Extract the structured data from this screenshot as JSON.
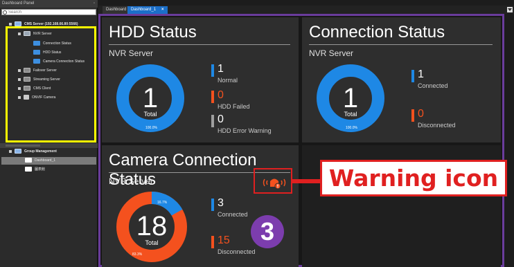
{
  "left_panel": {
    "title": "Dashboard Panel",
    "pin_icon": "pin-icon",
    "search_placeholder": "Search",
    "tree": [
      {
        "label": "CMS Server (192.168.66.80:5566)",
        "icon": "server-icon"
      },
      {
        "label": "NVR Server",
        "icon": "nvr-icon"
      },
      {
        "label": "Connection Status",
        "icon": "folder-icon"
      },
      {
        "label": "HDD Status",
        "icon": "folder-icon"
      },
      {
        "label": "Camera Connection Status",
        "icon": "folder-icon"
      },
      {
        "label": "Failover Server",
        "icon": "failover-icon"
      },
      {
        "label": "Streaming Server",
        "icon": "streaming-icon"
      },
      {
        "label": "CMS Client",
        "icon": "client-icon"
      },
      {
        "label": "ONVIF Camera",
        "icon": "onvif-icon"
      }
    ],
    "group": {
      "title": "Group Management",
      "items": [
        {
          "label": "Dashboard_1"
        },
        {
          "label": "圖表館"
        }
      ]
    }
  },
  "tabs": [
    {
      "label": "Dashboard",
      "active": false
    },
    {
      "label": "Dashboard_1",
      "active": true,
      "close": "×"
    }
  ],
  "widgets": {
    "hdd": {
      "title": "HDD Status",
      "subtitle": "NVR Server",
      "total": "1",
      "total_label": "Total",
      "pct": "100.0%",
      "legend": [
        {
          "value": "1",
          "label": "Normal",
          "color": "#1e88e5"
        },
        {
          "value": "0",
          "label": "HDD Failed",
          "color": "#f4511e"
        },
        {
          "value": "0",
          "label": "HDD Error Warning",
          "color": "#9e9e9e"
        }
      ]
    },
    "connection": {
      "title": "Connection Status",
      "subtitle": "NVR Server",
      "total": "1",
      "total_label": "Total",
      "pct": "100.0%",
      "legend": [
        {
          "value": "1",
          "label": "Connected",
          "color": "#1e88e5"
        },
        {
          "value": "0",
          "label": "Disconnected",
          "color": "#f4511e"
        }
      ]
    },
    "camera": {
      "title": "Camera Connection Status",
      "subtitle": "NVR Server",
      "total": "18",
      "total_label": "Total",
      "pct_connected": "16.7%",
      "pct_disconnected": "83.3%",
      "connected_fraction": 0.167,
      "legend": [
        {
          "value": "3",
          "label": "Connected",
          "color": "#1e88e5"
        },
        {
          "value": "15",
          "label": "Disconnected",
          "color": "#f4511e"
        }
      ]
    }
  },
  "annotation": {
    "label": "Warning icon",
    "badge": "3",
    "color": "#e02020"
  }
}
